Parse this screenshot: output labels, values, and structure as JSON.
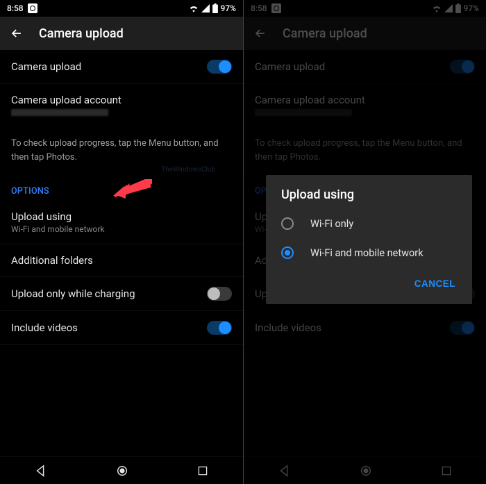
{
  "status": {
    "time": "8:58",
    "battery": "97%"
  },
  "header": {
    "title": "Camera upload"
  },
  "rows": {
    "camera_upload": {
      "label": "Camera upload",
      "on": true
    },
    "account": {
      "label": "Camera upload account"
    },
    "hint": "To check upload progress, tap the Menu button, and then tap Photos.",
    "section": "OPTIONS",
    "upload_using": {
      "label": "Upload using",
      "sub": "Wi-Fi and mobile network"
    },
    "additional_folders": {
      "label": "Additional folders"
    },
    "charging": {
      "label": "Upload only while charging",
      "on": false
    },
    "videos": {
      "label": "Include videos",
      "on": true
    }
  },
  "dialog": {
    "title": "Upload using",
    "option_wifi": "Wi-Fi only",
    "option_both": "Wi-Fi and mobile network",
    "cancel": "CANCEL"
  },
  "watermark": "TheWindowsClub"
}
